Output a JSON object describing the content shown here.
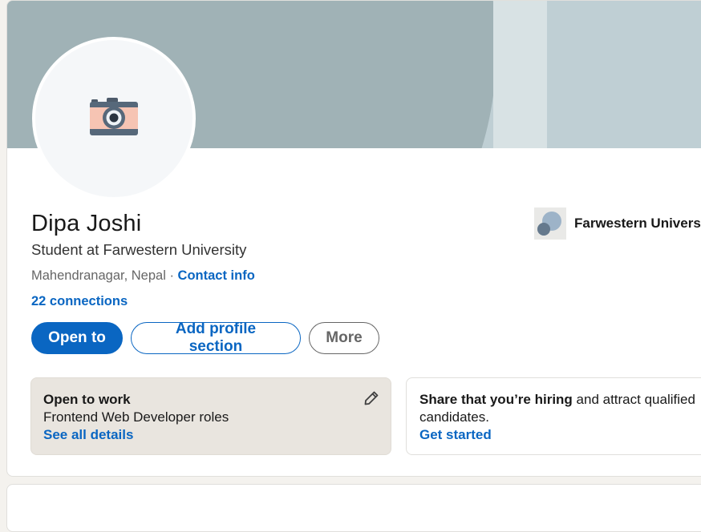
{
  "profile": {
    "name": "Dipa Joshi",
    "headline": "Student at Farwestern University",
    "location": "Mahendranagar, Nepal",
    "separator": " · ",
    "contact_info": "Contact info",
    "connections": "22 connections"
  },
  "actions": {
    "open_to": "Open to",
    "add_section": "Add profile section",
    "more": "More"
  },
  "school": {
    "name": "Farwestern University"
  },
  "open_to_work": {
    "title": "Open to work",
    "roles": "Frontend Web Developer roles",
    "details_link": "See all details"
  },
  "hiring": {
    "strong_text": "Share that you’re hiring",
    "rest_text": " and attract qualified candidates.",
    "cta": "Get started"
  },
  "icons": {
    "avatar": "camera-icon",
    "edit": "pencil-icon"
  },
  "colors": {
    "accent": "#0a66c2",
    "banner": "#a0b2b6",
    "open_to_work_bg": "#e9e5df"
  }
}
